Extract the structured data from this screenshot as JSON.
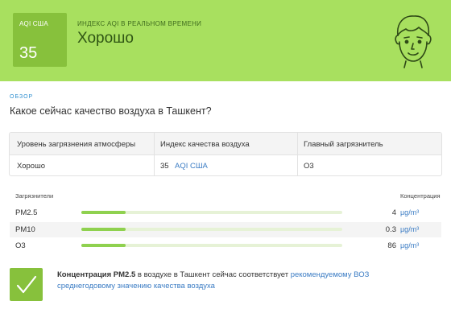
{
  "header": {
    "aqi_label": "AQI США",
    "aqi_value": "35",
    "subtitle": "ИНДЕКС AQI В РЕАЛЬНОМ ВРЕМЕНИ",
    "status": "Хорошо",
    "colors": {
      "banner": "#a8e05f",
      "aqi_box": "#87c13c"
    }
  },
  "overview": {
    "tag": "ОБЗОР",
    "question": "Какое сейчас качество воздуха в Ташкент?"
  },
  "summary_table": {
    "headers": [
      "Уровень загрязнения атмосферы",
      "Индекс качества воздуха",
      "Главный загрязнитель"
    ],
    "row": {
      "level": "Хорошо",
      "aqi_value": "35",
      "aqi_unit": "AQI США",
      "main_pollutant": "O3"
    }
  },
  "pollutants": {
    "label": "Загрязнители",
    "concentration_label": "Концентрация",
    "items": [
      {
        "name": "PM2.5",
        "value": "4",
        "unit": "µg/m³",
        "level": 0.17
      },
      {
        "name": "PM10",
        "value": "0.3",
        "unit": "µg/m³",
        "level": 0.17
      },
      {
        "name": "O3",
        "value": "86",
        "unit": "µg/m³",
        "level": 0.17
      }
    ]
  },
  "recommendation": {
    "bold": "Концентрация PM2.5",
    "text": " в воздухе в Ташкент сейчас соответствует ",
    "link": "рекомендуемому ВОЗ среднегодовому значению качества воздуха"
  }
}
